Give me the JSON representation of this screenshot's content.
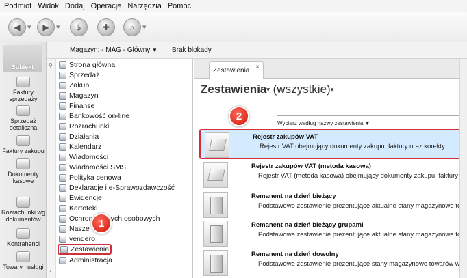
{
  "menu": [
    "Podmiot",
    "Widok",
    "Dodaj",
    "Operacje",
    "Narzędzia",
    "Pomoc"
  ],
  "toolbar": {
    "icons": [
      "back-icon",
      "forward-icon",
      "dollar-icon",
      "gift-icon",
      "search-icon"
    ]
  },
  "logo": {
    "text": "Subiekt"
  },
  "leftnav": [
    {
      "label": "Faktury sprzedaży",
      "icon": "invoice-icon"
    },
    {
      "label": "Sprzedaż detaliczna",
      "icon": "retail-icon"
    },
    {
      "label": "Faktury zakupu",
      "icon": "purchase-invoice-icon"
    },
    {
      "label": "Dokumenty kasowe",
      "icon": "cash-document-icon"
    },
    {
      "label": "Rozrachunki wg dokumentów",
      "icon": "settlements-icon"
    },
    {
      "label": "Kontrahenci",
      "icon": "contractors-icon"
    },
    {
      "label": "Towary i usługi",
      "icon": "goods-icon"
    }
  ],
  "magbar": {
    "magazyn": "Magazyn: - MAG - Główny",
    "magazyn_arrow": "▼",
    "brak": "Brak blokady"
  },
  "tree": [
    "Strona główna",
    "Sprzedaż",
    "Zakup",
    "Magazyn",
    "Finanse",
    "Bankowość on-line",
    "Rozrachunki",
    "Działania",
    "Kalendarz",
    "Wiadomości",
    "Wiadomości SMS",
    "Polityka cenowa",
    "Deklaracje i e-Sprawozdawczość",
    "Ewidencje",
    "Kartoteki",
    "Ochrona danych osobowych",
    "Nasze",
    "vendero",
    "Zestawienia",
    "Administracja"
  ],
  "tab": {
    "label": "Zestawienia",
    "close": "×"
  },
  "heading": {
    "part1": "Zestawienia",
    "part2": "(wszystkie)",
    "caret": "▾"
  },
  "search": {
    "value": "",
    "hint": "Wybierz według nazwy zestawienia",
    "hint_arrow": "▼"
  },
  "rows": [
    {
      "title": "Rejestr zakupów VAT",
      "desc": "Rejestr VAT obejmujący dokumenty zakupu: faktury oraz korekty.",
      "selected": true,
      "thumb": "stack"
    },
    {
      "title": "Rejestr zakupów VAT (metoda kasowa)",
      "desc": "Rejestr VAT (metoda kasowa) obejmujący dokumenty zakupu: faktury on",
      "selected": false,
      "thumb": "stack"
    },
    {
      "title": "Remanent na dzień bieżący",
      "desc": "Podstawowe zestawienie prezentujące aktualne stany magazynowe tow",
      "selected": false,
      "thumb": "box"
    },
    {
      "title": "Remanent na dzień bieżący grupami",
      "desc": "Podstawowe zestawienie prezentujące aktualne stany magazynowe tow",
      "selected": false,
      "thumb": "box"
    },
    {
      "title": "Remanent na dzień dowolny",
      "desc": "Podstawowe zestawienie prezentujące stany magazynowe towarów w r",
      "selected": false,
      "thumb": "box"
    }
  ],
  "badges": {
    "one": "1",
    "two": "2"
  },
  "colors": {
    "highlight": "#d32f3b",
    "selected_bg": "#d4ebff"
  }
}
